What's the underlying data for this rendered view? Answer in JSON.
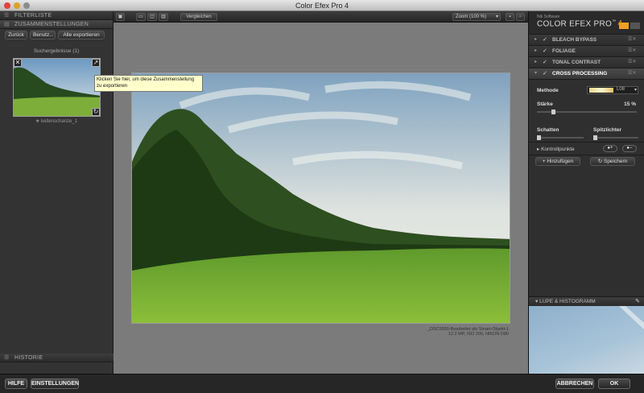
{
  "window": {
    "title": "Color Efex Pro 4"
  },
  "left": {
    "filterliste": "FILTERLISTE",
    "zusammenstellungen": "ZUSAMMENSTELLUNGEN",
    "buttons": [
      "Zurück",
      "Benutz...",
      "Alle exportieren"
    ],
    "results_label": "Suchergebnisse (1)",
    "thumb_caption": "keltenschanze_1",
    "historie": "HISTORIE",
    "tooltip": "Klicken Sie hier, um diese Zusammenstellung zu exportieren"
  },
  "center": {
    "compare_label": "Vergleichen",
    "zoom_label": "Zoom (100 %)",
    "caption_line1": "_DSC0050-Bearbeitet als Smart-Objekt-1",
    "caption_line2": "12.2 MP, ISO 200, NIKON D80"
  },
  "right": {
    "brand_small": "Nik Software",
    "brand": "COLOR EFEX PRO",
    "brand_tm": "™",
    "brand_version": "4",
    "filters": [
      {
        "label": "BLEACH BYPASS"
      },
      {
        "label": "FOLIAGE"
      },
      {
        "label": "TONAL CONTRAST"
      },
      {
        "label": "CROSS PROCESSING"
      }
    ],
    "methode_label": "Methode",
    "methode_value": "L08",
    "staerke_label": "Stärke",
    "staerke_value": "15 %",
    "schatten_label": "Schatten",
    "spitzlichter_label": "Spitzlichter",
    "kontrollpunkte_label": "Kontrollpunkte",
    "hinzufuegen_label": "Hinzufügen",
    "speichern_label": "Speichern",
    "lupe_label": "LUPE & HISTOGRAMM"
  },
  "bottom": {
    "hilfe": "HILFE",
    "einstellungen": "EINSTELLUNGEN",
    "abbrechen": "ABBRECHEN",
    "ok": "OK"
  },
  "colors": {
    "accent": "#f0a020",
    "tooltip_bg": "#ffffcc"
  }
}
